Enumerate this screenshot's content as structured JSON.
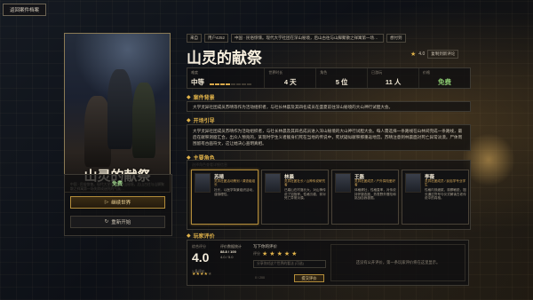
{
  "back_button": "返回案件档案",
  "poster": {
    "title": "山灵的献祭",
    "desc": "中国 · 民俗惊悚。现代大学社团在深山秘境，后山古往与山脚聚散之祥寓第一场失踪成迷死的气氛…"
  },
  "actions": {
    "price": "免费",
    "continue_label": "继续世界",
    "restart_label": "重新开始"
  },
  "meta": {
    "tag_source": "来自",
    "tag_id": "用户4252",
    "tag_desc": "中国 · 民俗惊悚。现代大学社团在深山秘境，后山古往与山脚聚散之祥寓第一场失踪成迷死的气氛…",
    "tag_extra": "想付到"
  },
  "title": "山灵的献祭",
  "rating_top": {
    "score": "4.0",
    "share": "复制到新评论"
  },
  "stats": [
    {
      "label": "难度",
      "value": "中等",
      "bars": 4,
      "total": 8
    },
    {
      "label": "世界时长",
      "value": "4 天"
    },
    {
      "label": "角色",
      "value": "5 位"
    },
    {
      "label": "已游玩",
      "value": "11 人"
    },
    {
      "label": "价格",
      "value": "免费"
    }
  ],
  "sections": {
    "background_title": "案件背景",
    "background_text": "大学灵异社团成员苏晴等作为活动组织者，与社长林晨及其四名成员在盛夏前往深山秘境的大山神行试胆大会。",
    "intro_title": "开场引导",
    "intro_text": "大学灵异社团成员苏晴作为活动组织者，与社长林晨及其四名成员进入深山秘境的大山神行试胆大会。每人需选择一条路线在山林间完成一条路线，最后在献祭洞窟汇合。出众人预兆的，某现时学生义者舰身们死在当地的传说中，死状疑似献祭那重返地宫。苏晴注意到林晨面对死亡异常淡漠。尸体周围留有古画符文，这让她决心查明真相。",
    "roles_title": "主要角色",
    "roles_hint": "选择角色查看详细信息"
  },
  "characters": [
    {
      "name": "苏晴",
      "role": "灵异社团活动策划 / 调查组组长",
      "desc": "社长，以医学背景组织活动，谨慎理性。"
    },
    {
      "name": "林晨",
      "role": "灵异社团社长 / 山神传说研究者",
      "desc": "已婚山在村落长大，对山神传说了如指掌。性格沉稳，却对死亡异常淡漠。"
    },
    {
      "name": "王磊",
      "role": "灵异社团成员 / 户外探险爱好者",
      "desc": "体格健壮，性格直率，对传说持怀疑态度，热衷野外冒险和挑战自我极限。"
    },
    {
      "name": "李薇",
      "role": "灵异社团成员 / 民俗学专业学生",
      "desc": "性格内敛细腻，观察敏锐，擅长通过符号与仪式解读古老传说中的真相。"
    }
  ],
  "player_rating": {
    "title": "玩家评价",
    "label": "综合评分",
    "score": "4.0",
    "count": "1 条评价",
    "mid_label": "评价数据统计",
    "mid_line1": "88.8 / 100",
    "mid_line2": "4.0 / 5.0",
    "write_title": "写下你的评价",
    "write_stars_label": "评分",
    "placeholder": "分享你对这个世界的看法 (可选)",
    "char_count": "0 / 200",
    "submit": "提交评价",
    "empty": "还没有公开评价，第一条玩家评价将在这里显示。"
  },
  "colors": {
    "accent": "#e0b24a",
    "free": "#8ccb72"
  }
}
